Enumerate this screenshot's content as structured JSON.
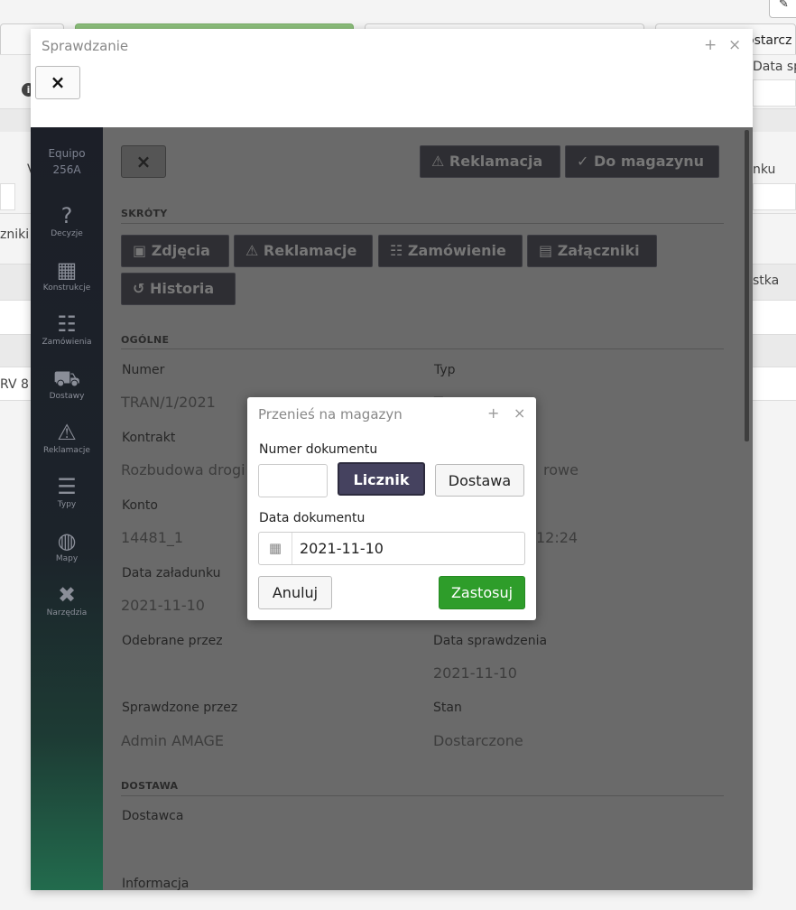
{
  "background": {
    "tab_partial": "ostarcz",
    "col_label": "Data sp",
    "right_text": "nku",
    "left_text": "zniki",
    "col_text2": "stka",
    "row_text": "RV 8",
    "v_text": "V"
  },
  "modal": {
    "title": "Sprawdzanie",
    "pin_icon_glyph": "+",
    "close_icon_glyph": "×",
    "close_button_glyph": "×"
  },
  "sidebar": {
    "brand_line1": "Equipo",
    "brand_line2": "256A",
    "items": [
      {
        "label": "Decyzje",
        "icon": "question-icon",
        "glyph": "?"
      },
      {
        "label": "Konstrukcje",
        "icon": "building-icon",
        "glyph": "▦"
      },
      {
        "label": "Zamówienia",
        "icon": "abacus-icon",
        "glyph": "☷"
      },
      {
        "label": "Dostawy",
        "icon": "truck-icon",
        "glyph": "⛟"
      },
      {
        "label": "Reklamacje",
        "icon": "warning-icon",
        "glyph": "⚠"
      },
      {
        "label": "Typy",
        "icon": "list-icon",
        "glyph": "☰"
      },
      {
        "label": "Mapy",
        "icon": "globe-icon",
        "glyph": "◍"
      },
      {
        "label": "Narzędzia",
        "icon": "tools-icon",
        "glyph": "✖"
      }
    ]
  },
  "toolbar": {
    "close_glyph": "×",
    "reklamacja_label": "Reklamacja",
    "reklamacja_glyph": "⚠",
    "do_magazynu_label": "Do magazynu",
    "do_magazynu_glyph": "✓"
  },
  "shortcuts": {
    "title": "SKRÓTY",
    "items": [
      {
        "label": "Zdjęcia",
        "glyph": "▣"
      },
      {
        "label": "Reklamacje",
        "glyph": "⚠"
      },
      {
        "label": "Zamówienie",
        "glyph": "☷"
      },
      {
        "label": "Załączniki",
        "glyph": "▤"
      },
      {
        "label": "Historia",
        "glyph": "↺"
      }
    ]
  },
  "general": {
    "title": "OGÓLNE",
    "numer_label": "Numer",
    "numer_value": "TRAN/1/2021",
    "typ_label": "Typ",
    "typ_value": "T",
    "kontrakt_label": "Kontrakt",
    "kontrakt_value": "Rozbudowa drogi w",
    "kontrakt_right": "rowe",
    "konto_label": "Konto",
    "konto_value": "14481_1",
    "konto_right": "12:24",
    "data_zaladunku_label": "Data załadunku",
    "data_zaladunku_value": "2021-11-10",
    "odebrane_label": "Odebrane przez",
    "data_sprawdzenia_label": "Data sprawdzenia",
    "data_sprawdzenia_value": "2021-11-10",
    "sprawdzone_label": "Sprawdzone przez",
    "sprawdzone_value": "Admin AMAGE",
    "stan_label": "Stan",
    "stan_value": "Dostarczone"
  },
  "delivery": {
    "title": "DOSTAWA",
    "dostawca_label": "Dostawca",
    "informacja_label": "Informacja"
  },
  "dialog": {
    "title": "Przenieś na magazyn",
    "pin_glyph": "+",
    "close_glyph": "×",
    "numer_label": "Numer dokumentu",
    "numer_value": "",
    "licznik_label": "Licznik",
    "dostawa_label": "Dostawa",
    "data_label": "Data dokumentu",
    "data_value": "2021-11-10",
    "calendar_glyph": "▦",
    "cancel_label": "Anuluj",
    "apply_label": "Zastosuj"
  },
  "colors": {
    "apply_green": "#2e9d2a",
    "licznik_purple": "#45425f",
    "overlay": "#6a6a6a"
  }
}
